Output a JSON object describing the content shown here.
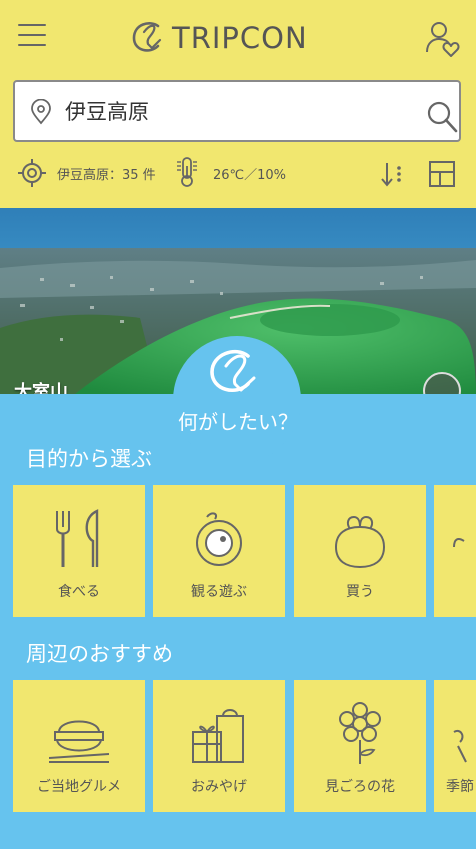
{
  "header": {
    "logo_text": "TRIPCON"
  },
  "search": {
    "value": "伊豆高原"
  },
  "status": {
    "location_count": "伊豆高原：35 件",
    "weather": "26℃／10%"
  },
  "hero": {
    "label": "大室山"
  },
  "panel": {
    "question": "何がしたい？",
    "section_purpose": "目的から選ぶ",
    "section_nearby": "周辺のおすすめ",
    "purpose_cards": [
      {
        "label": "食べる",
        "icon": "fork-knife-icon"
      },
      {
        "label": "観る遊ぶ",
        "icon": "viewfinder-icon"
      },
      {
        "label": "買う",
        "icon": "purse-icon"
      },
      {
        "label": "",
        "icon": "partial-card-icon"
      }
    ],
    "nearby_cards": [
      {
        "label": "ご当地グルメ",
        "icon": "rice-bowl-icon"
      },
      {
        "label": "おみやげ",
        "icon": "gift-bag-icon"
      },
      {
        "label": "見ごろの花",
        "icon": "flower-icon"
      },
      {
        "label": "季節",
        "icon": "partial-card-icon"
      }
    ]
  },
  "colors": {
    "yellow": "#f1e76f",
    "blue": "#66c3ee",
    "text": "#555555"
  }
}
